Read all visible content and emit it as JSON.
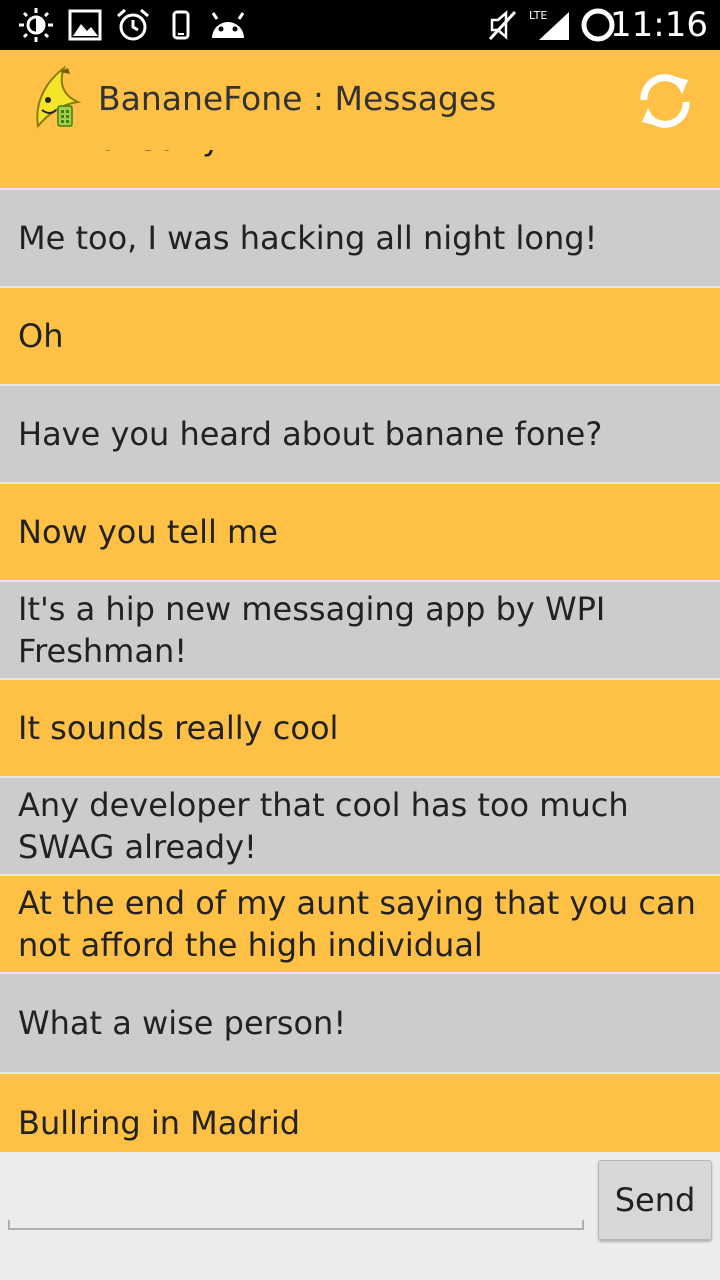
{
  "status_bar": {
    "time": "11:16",
    "network": "LTE",
    "icons": [
      "brightness-icon",
      "gallery-icon",
      "alarm-icon",
      "phone-icon",
      "android-icon",
      "mute-icon",
      "signal-icon",
      "ring-icon"
    ]
  },
  "action_bar": {
    "title": "BananeFone : Messages",
    "logo_icon": "banana-phone-icon",
    "refresh_icon": "refresh-icon",
    "background_color": "#ffc145"
  },
  "messages": [
    {
      "text": "I'm not sorry!",
      "color": "yellow"
    },
    {
      "text": "Me too,  I was hacking all night long!",
      "color": "grey"
    },
    {
      "text": "Oh",
      "color": "yellow"
    },
    {
      "text": "Have you heard about banane fone?",
      "color": "grey"
    },
    {
      "text": "Now you tell me",
      "color": "yellow"
    },
    {
      "text": "It's a hip new messaging app by WPI Freshman!",
      "color": "grey"
    },
    {
      "text": "It sounds really cool",
      "color": "yellow"
    },
    {
      "text": "Any developer that cool has too much SWAG already!",
      "color": "grey"
    },
    {
      "text": "At the end of my aunt saying that you can not afford the high individual",
      "color": "yellow"
    },
    {
      "text": "What a wise person!",
      "color": "grey"
    },
    {
      "text": "Bullring in Madrid",
      "color": "yellow"
    }
  ],
  "composer": {
    "input_value": "",
    "send_label": "Send"
  },
  "colors": {
    "yellow": "#ffc145",
    "grey": "#cccccc"
  }
}
